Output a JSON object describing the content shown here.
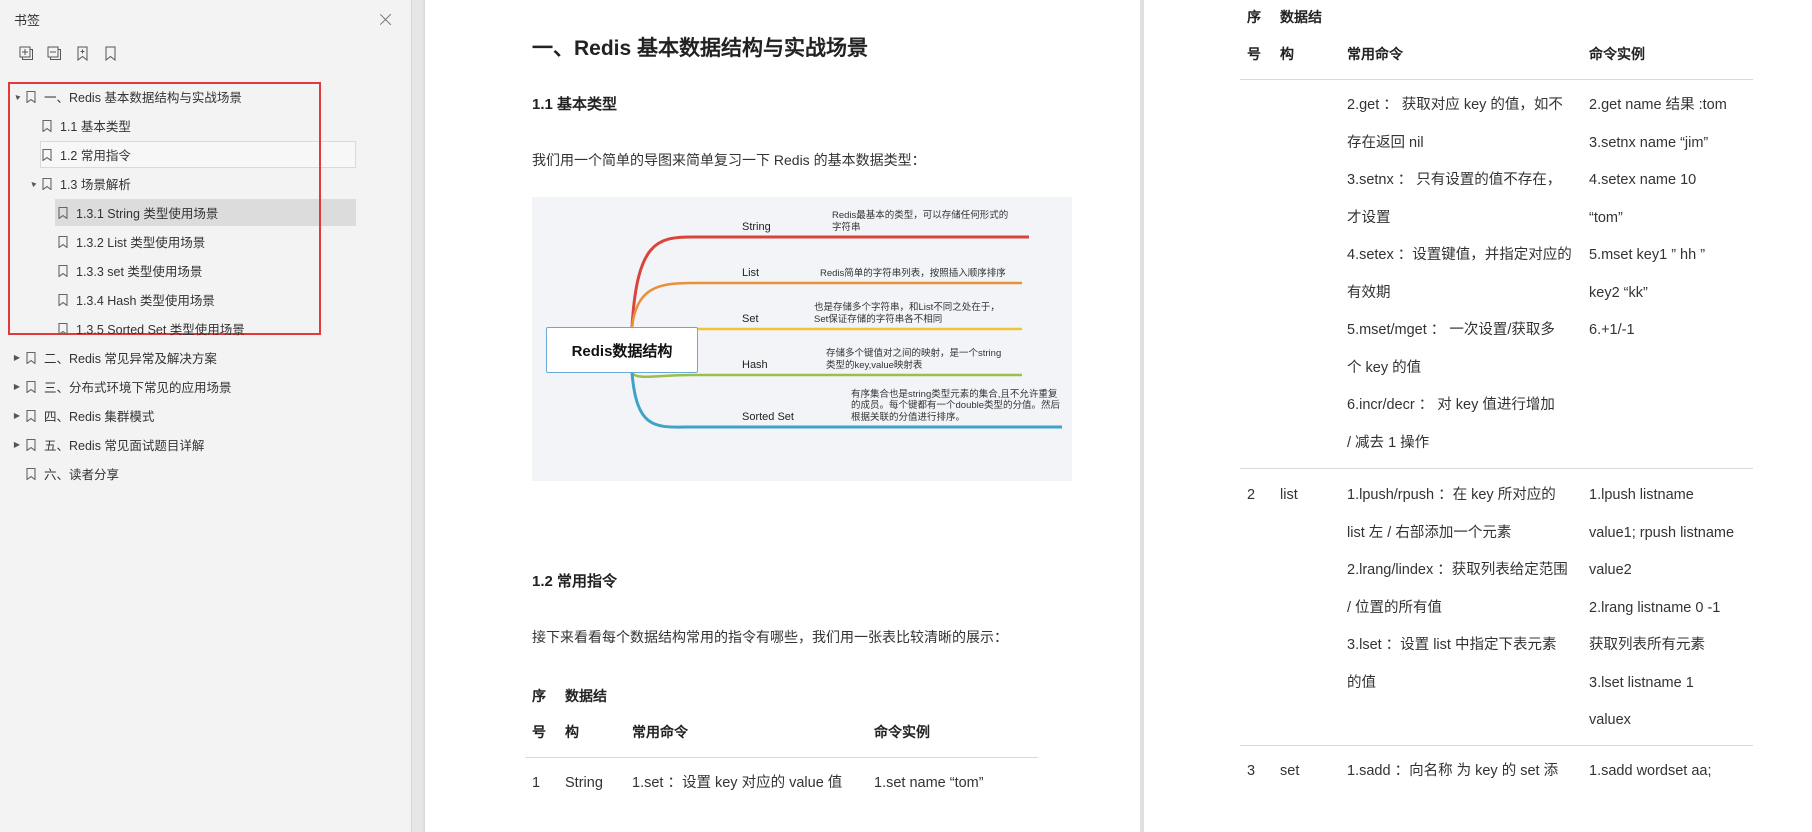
{
  "sidebar": {
    "title": "书签",
    "tools": [
      "expand-all-icon",
      "collapse-all-icon",
      "add-bookmark-icon",
      "bookmark-icon"
    ],
    "items": [
      {
        "label": "一、Redis 基本数据结构与实战场景",
        "level": 0,
        "arrow": "▲"
      },
      {
        "label": "1.1 基本类型",
        "level": 1,
        "arrow": ""
      },
      {
        "label": "1.2 常用指令",
        "level": 1,
        "arrow": ""
      },
      {
        "label": "1.3 场景解析",
        "level": 1,
        "arrow": "▲"
      },
      {
        "label": "1.3.1 String 类型使用场景",
        "level": 2,
        "arrow": ""
      },
      {
        "label": "1.3.2 List 类型使用场景",
        "level": 2,
        "arrow": ""
      },
      {
        "label": "1.3.3 set 类型使用场景",
        "level": 2,
        "arrow": ""
      },
      {
        "label": "1.3.4 Hash 类型使用场景",
        "level": 2,
        "arrow": ""
      },
      {
        "label": "1.3.5 Sorted Set 类型使用场景",
        "level": 2,
        "arrow": ""
      },
      {
        "label": "二、Redis 常见异常及解决方案",
        "level": 0,
        "arrow": "▶"
      },
      {
        "label": "三、分布式环境下常见的应用场景",
        "level": 0,
        "arrow": "▶"
      },
      {
        "label": "四、Redis 集群模式",
        "level": 0,
        "arrow": "▶"
      },
      {
        "label": "五、Redis 常见面试题目详解",
        "level": 0,
        "arrow": "▶"
      },
      {
        "label": "六、读者分享",
        "level": 0,
        "arrow": ""
      }
    ]
  },
  "page1": {
    "heading": "一、Redis 基本数据结构与实战场景",
    "section1": "1.1 基本类型",
    "intro1": "我们用一个简单的导图来简单复习一下 Redis 的基本数据类型：",
    "mindmap": {
      "center": "Redis数据结构",
      "branches": [
        {
          "label": "String",
          "desc": "Redis最基本的类型，可以存储任何形式的字符串",
          "color": "#d9453d"
        },
        {
          "label": "List",
          "desc": "Redis简单的字符串列表，按照插入顺序排序",
          "color": "#e8903a"
        },
        {
          "label": "Set",
          "desc": "也是存储多个字符串，和List不同之处在于，Set保证存储的字符串各不相同",
          "color": "#f0c43a"
        },
        {
          "label": "Hash",
          "desc": "存储多个键值对之间的映射，是一个string类型的key,value映射表",
          "color": "#9bbf4a"
        },
        {
          "label": "Sorted Set",
          "desc": "有序集合也是string类型元素的集合,且不允许重复的成员。每个键都有一个double类型的分值。然后根据关联的分值进行排序。",
          "color": "#3fa3c8"
        }
      ]
    },
    "section2": "1.2 常用指令",
    "intro2": "接下来看看每个数据结构常用的指令有哪些，我们用一张表比较清晰的展示：",
    "table_header": {
      "col1a": "序",
      "col1b": "号",
      "col2a": "数据结",
      "col2b": "构",
      "col3": "常用命令",
      "col4": "命令实例"
    },
    "row1": {
      "no": "1",
      "type": "String",
      "cmd": "1.set ：设置 key 对应的 value 值",
      "example": "1.set name “tom”"
    }
  },
  "page2": {
    "table_header": {
      "col1a": "序",
      "col1b": "号",
      "col2a": "数据结",
      "col2b": "构",
      "col3": "常用命令",
      "col4": "命令实例"
    },
    "row1_cont": {
      "cmd": [
        "2.get ： 获取对应 key 的值，如不",
        "存在返回 nil",
        "3.setnx ： 只有设置的值不存在，",
        "才设置",
        "4.setex ：设置键值，并指定对应的",
        "有效期",
        "5.mset/mget ： 一次设置/获取多",
        "个 key 的值",
        "6.incr/decr ： 对 key 值进行增加",
        "/ 减去 1 操作"
      ],
      "example": [
        "2.get name 结果 :tom",
        "3.setnx name “jim”",
        "4.setex      name      10",
        "“tom”",
        "5.mset  key1    ” hh ”",
        "key2 “kk”",
        "6.+1/-1"
      ]
    },
    "row2": {
      "no": "2",
      "type": "list",
      "cmd": [
        "1.lpush/rpush ：在 key 所对应的",
        "list 左 / 右部添加一个元素",
        "2.lrang/lindex ：获取列表给定范围",
        "/ 位置的所有值",
        "3.lset ：设置 list 中指定下表元素",
        "的值"
      ],
      "example": [
        "1.lpush           listname",
        "value1; rpush listname",
        "value2",
        "2.lrang  listname  0  -1",
        "获取列表所有元素",
        "3.lset      listname      1",
        "valuex"
      ]
    },
    "row3": {
      "no": "3",
      "type": "set",
      "cmd": "1.sadd ：向名称 为 key 的 set 添",
      "example": "1.sadd      wordset      aa;"
    }
  }
}
